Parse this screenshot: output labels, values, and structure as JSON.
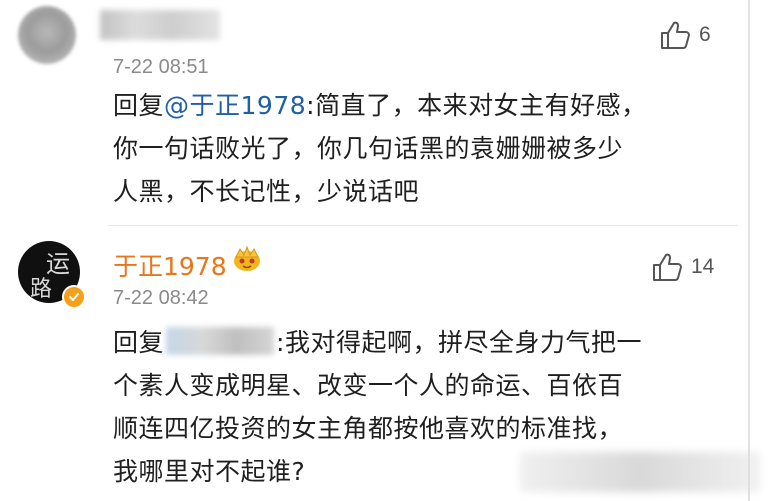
{
  "comments": [
    {
      "time": "7-22 08:51",
      "likes": "6",
      "reply_word": "回复",
      "mention": "@于正1978",
      "lines": [
        ":简直了，本来对女主有好感，",
        "你一句话败光了，你几句话黑的袁姗姗被多少",
        "人黑，不长记性，少说话吧"
      ]
    },
    {
      "username": "于正1978",
      "avatar_glyphs": [
        "运",
        "路"
      ],
      "time": "7-22 08:42",
      "likes": "14",
      "reply_word": "回复",
      "lines": [
        ":我对得起啊，拼尽全身力气把一",
        "个素人变成明星、改变一个人的命运、百依百",
        "顺连四亿投资的女主角都按他喜欢的标准找，",
        "我哪里对不起谁?"
      ]
    }
  ],
  "colors": {
    "username": "#e8761a",
    "mention": "#1f5fa6",
    "time": "#8a8a8a",
    "verified_badge": "#f7a11a",
    "crown": "#f2b61a"
  },
  "icons": {
    "like": "thumbs-up-icon",
    "crown": "crown-icon",
    "verified": "verified-badge-icon"
  }
}
